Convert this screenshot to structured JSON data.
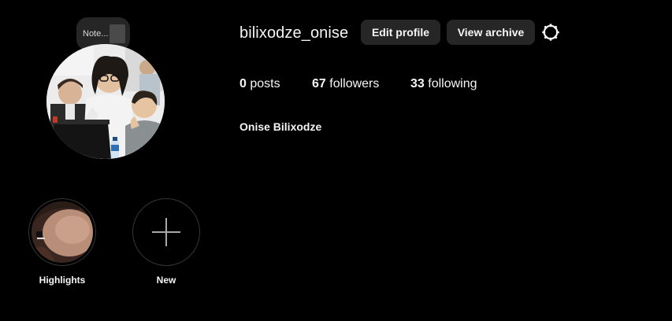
{
  "note": {
    "text": "Note..."
  },
  "profile": {
    "username": "bilixodze_onise",
    "full_name": "Onise Bilixodze",
    "edit_label": "Edit profile",
    "archive_label": "View archive",
    "settings_icon": "settings-gear-icon"
  },
  "stats": {
    "posts_count": "0",
    "posts_label": "posts",
    "followers_count": "67",
    "followers_label": "followers",
    "following_count": "33",
    "following_label": "following"
  },
  "highlights": [
    {
      "label": "Highlights"
    },
    {
      "label": "New",
      "icon": "plus-icon"
    }
  ],
  "colors": {
    "background": "#000000",
    "button_bg": "#262626",
    "text": "#f5f5f5"
  }
}
